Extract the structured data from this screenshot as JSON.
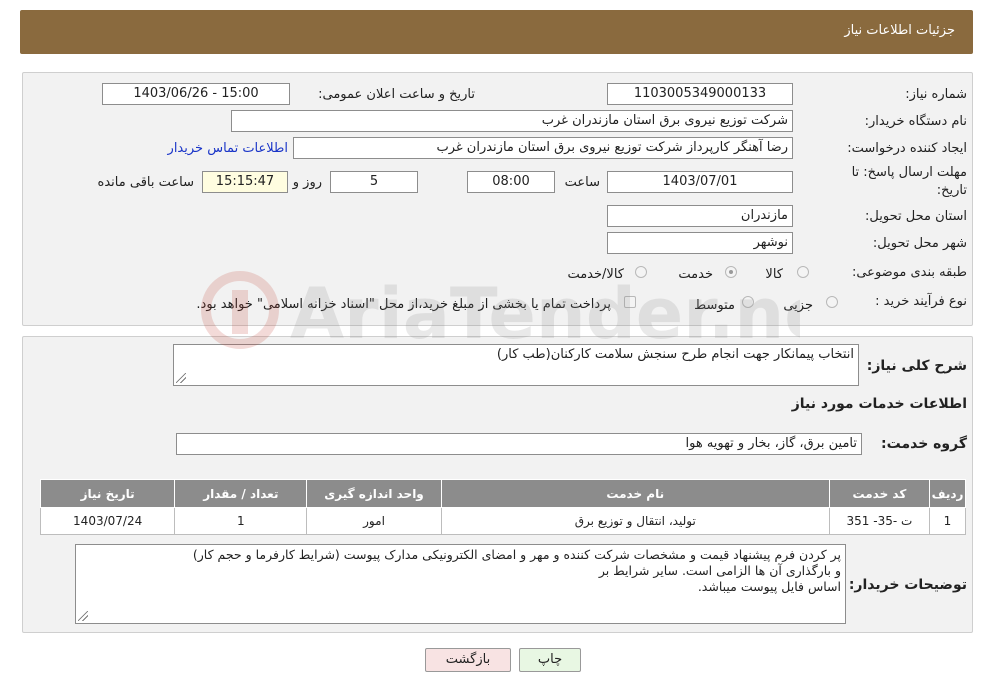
{
  "header": {
    "title": "جزئیات اطلاعات نیاز"
  },
  "info": {
    "need_number_label": "شماره نیاز:",
    "need_number": "1103005349000133",
    "announce_label": "تاریخ و ساعت اعلان عمومی:",
    "announce_value": "1403/06/26 - 15:00",
    "buyer_org_label": "نام دستگاه خریدار:",
    "buyer_org": "شرکت توزیع نیروی برق استان مازندران غرب",
    "creator_label": "ایجاد کننده درخواست:",
    "creator": "رضا آهنگر کارپرداز شرکت توزیع نیروی برق استان مازندران غرب",
    "contact_link": "اطلاعات تماس خریدار",
    "deadline_label_1": "مهلت ارسال پاسخ: تا",
    "deadline_label_2": "تاریخ:",
    "deadline_date": "1403/07/01",
    "time_label": "ساعت",
    "deadline_time": "08:00",
    "days_value": "5",
    "days_label": "روز و",
    "remaining_time": "15:15:47",
    "remaining_label": "ساعت باقی مانده",
    "province_label": "استان محل تحویل:",
    "province": "مازندران",
    "city_label": "شهر محل تحویل:",
    "city": "نوشهر",
    "category_label": "طبقه بندی موضوعی:",
    "category_options": [
      "کالا",
      "خدمت",
      "کالا/خدمت"
    ],
    "category_selected": "خدمت",
    "process_label": "نوع فرآیند خرید :",
    "process_options": [
      "جزیی",
      "متوسط"
    ],
    "process_note": "پرداخت تمام یا بخشی از مبلغ خرید،از محل \"اسناد خزانه اسلامی\" خواهد بود."
  },
  "details": {
    "desc_label": "شرح کلی نیاز:",
    "desc_value": "انتخاب پیمانکار جهت انجام طرح سنجش سلامت کارکنان(طب کار)",
    "services_title": "اطلاعات خدمات مورد نیاز",
    "group_label": "گروه خدمت:",
    "group_value": "تامین برق، گاز، بخار و تهویه هوا",
    "table": {
      "headers": [
        "ردیف",
        "کد خدمت",
        "نام خدمت",
        "واحد اندازه گیری",
        "تعداد / مقدار",
        "تاریخ نیاز"
      ],
      "rows": [
        [
          "1",
          "ت -35- 351",
          "تولید، انتقال و توزیع برق",
          "امور",
          "1",
          "1403/07/24"
        ]
      ]
    },
    "buyer_notes_label": "توضیحات خریدار:",
    "buyer_notes_line1": "پر کردن فرم پیشنهاد قیمت و مشخصات شرکت کننده و مهر و امضای الکترونیکی مدارک پیوست (شرایط کارفرما و حجم کار)",
    "buyer_notes_line2": "و بارگذاری آن ها الزامی است. سایر شرایط بر",
    "buyer_notes_line3": "اساس فایل پیوست میباشد."
  },
  "buttons": {
    "print": "چاپ",
    "back": "بازگشت"
  },
  "watermark": {
    "text": "AriaTender.neT"
  },
  "colors": {
    "header": "#8a6a3e",
    "table_header": "#8c8c8c",
    "back_button": "#f8e3e3",
    "print_button": "#e8f7e3",
    "link": "#1a35c8"
  }
}
